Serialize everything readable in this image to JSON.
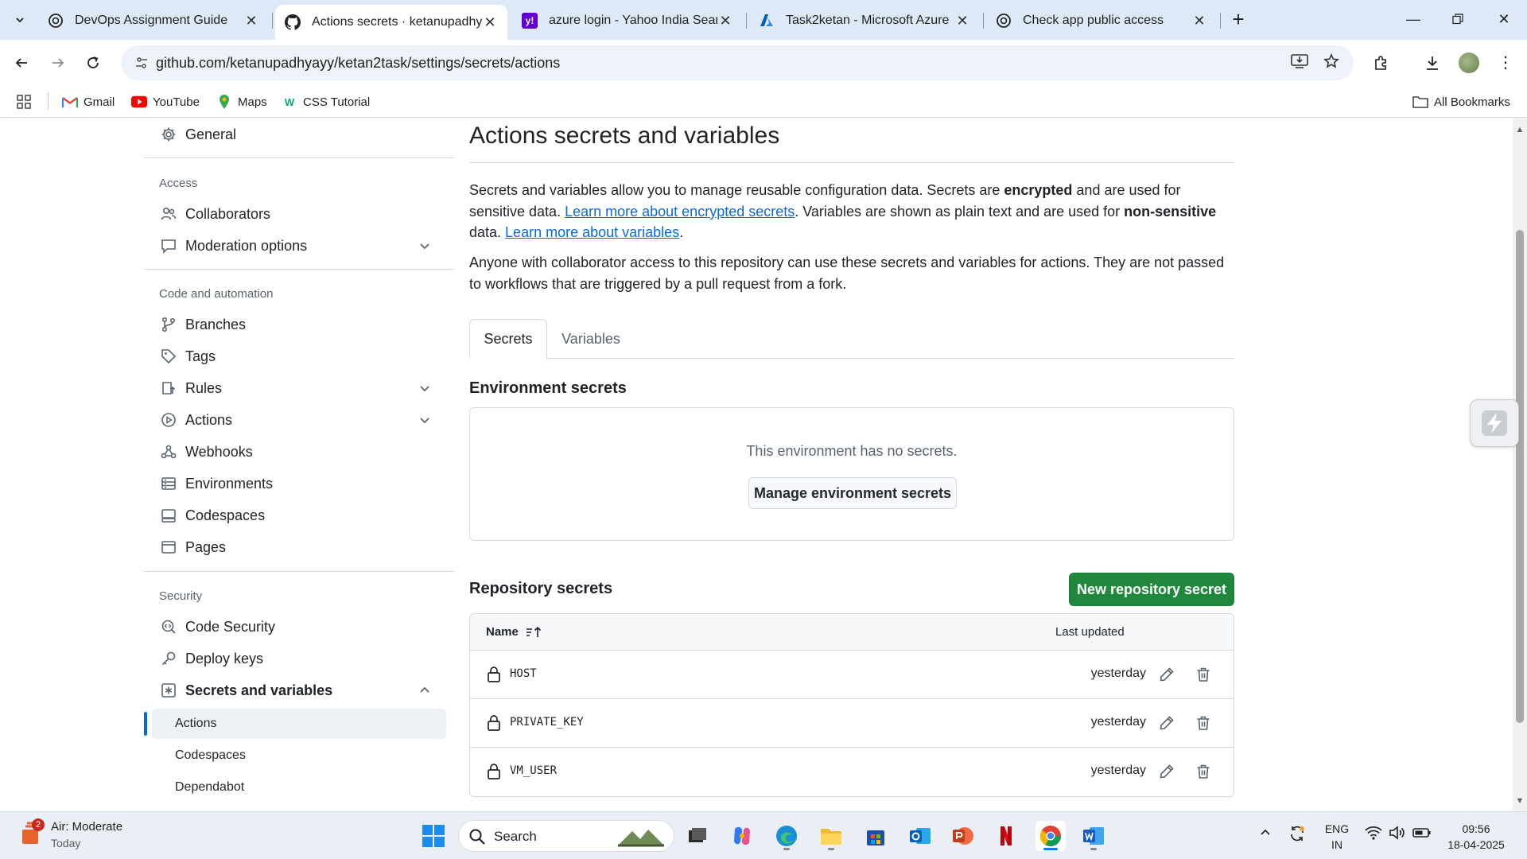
{
  "browser": {
    "tabs": [
      {
        "title": "DevOps Assignment Guide",
        "active": false
      },
      {
        "title": "Actions secrets · ketanupadhyayyy",
        "active": true
      },
      {
        "title": "azure login - Yahoo India Search",
        "active": false
      },
      {
        "title": "Task2ketan - Microsoft Azure",
        "active": false
      },
      {
        "title": "Check app public access",
        "active": false
      }
    ],
    "url": "github.com/ketanupadhyayy/ketan2task/settings/secrets/actions",
    "bookmarks": [
      {
        "label": "Gmail"
      },
      {
        "label": "YouTube"
      },
      {
        "label": "Maps"
      },
      {
        "label": "CSS Tutorial"
      }
    ],
    "all_bookmarks": "All Bookmarks"
  },
  "sidebar": {
    "general": "General",
    "access_heading": "Access",
    "collaborators": "Collaborators",
    "moderation": "Moderation options",
    "code_heading": "Code and automation",
    "branches": "Branches",
    "tags": "Tags",
    "rules": "Rules",
    "actions": "Actions",
    "webhooks": "Webhooks",
    "environments": "Environments",
    "codespaces": "Codespaces",
    "pages": "Pages",
    "security_heading": "Security",
    "code_security": "Code Security",
    "deploy_keys": "Deploy keys",
    "secrets_vars": "Secrets and variables",
    "sub_actions": "Actions",
    "sub_codespaces": "Codespaces",
    "sub_dependabot": "Dependabot"
  },
  "main": {
    "title": "Actions secrets and variables",
    "intro_1": "Secrets and variables allow you to manage reusable configuration data. Secrets are ",
    "intro_encrypted": "encrypted",
    "intro_2": " and are used for sensitive data. ",
    "intro_link1": "Learn more about encrypted secrets",
    "intro_3": ". Variables are shown as plain text and are used for ",
    "intro_nonsensitive": "non-sensitive",
    "intro_4": " data. ",
    "intro_link2": "Learn more about variables",
    "intro_5": ".",
    "access_note": "Anyone with collaborator access to this repository can use these secrets and variables for actions. They are not passed to workflows that are triggered by a pull request from a fork.",
    "tab_secrets": "Secrets",
    "tab_variables": "Variables",
    "env_heading": "Environment secrets",
    "env_empty": "This environment has no secrets.",
    "env_button": "Manage environment secrets",
    "repo_heading": "Repository secrets",
    "new_secret_button": "New repository secret",
    "col_name": "Name",
    "col_updated": "Last updated",
    "secrets": [
      {
        "name": "HOST",
        "updated": "yesterday"
      },
      {
        "name": "PRIVATE_KEY",
        "updated": "yesterday"
      },
      {
        "name": "VM_USER",
        "updated": "yesterday"
      }
    ]
  },
  "taskbar": {
    "weather_title": "Air: Moderate",
    "weather_sub": "Today",
    "weather_badge": "2",
    "search_label": "Search",
    "lang_1": "ENG",
    "lang_2": "IN",
    "time": "09:56",
    "date": "18-04-2025"
  },
  "colors": {
    "accent_link": "#0969da",
    "primary_button": "#1f883d",
    "browser_frame": "#dee9f7"
  }
}
